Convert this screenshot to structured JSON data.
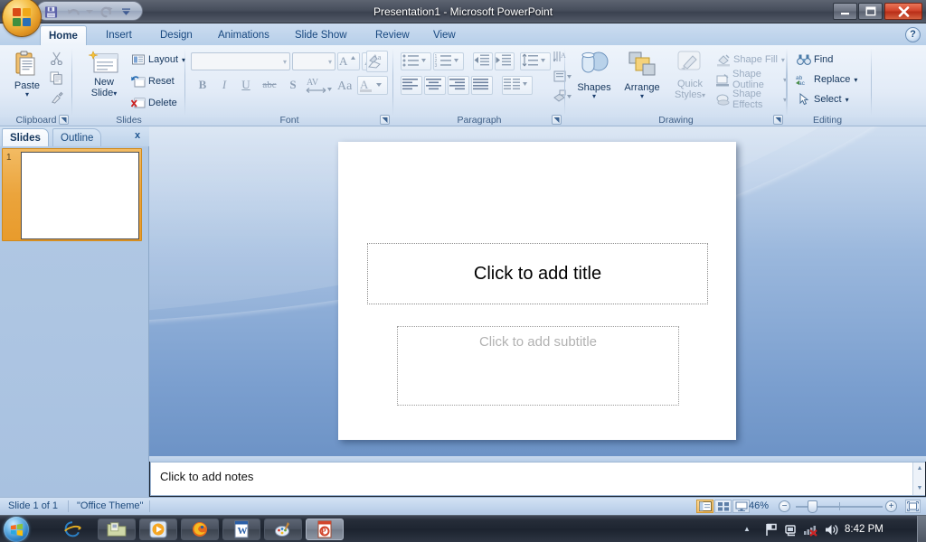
{
  "window": {
    "title": "Presentation1 - Microsoft PowerPoint",
    "minimize_label": "–",
    "maximize_label": "❐",
    "close_label": "✕",
    "help_label": "?"
  },
  "quick_access": {
    "save_icon": "save-icon",
    "undo_icon": "undo-icon",
    "redo_icon": "redo-icon",
    "customize_icon": "chevron-down-icon"
  },
  "office_button": {
    "name": "office-orb"
  },
  "ribbon": {
    "tabs": [
      {
        "label": "Home",
        "active": true
      },
      {
        "label": "Insert",
        "active": false
      },
      {
        "label": "Design",
        "active": false
      },
      {
        "label": "Animations",
        "active": false
      },
      {
        "label": "Slide Show",
        "active": false
      },
      {
        "label": "Review",
        "active": false
      },
      {
        "label": "View",
        "active": false
      }
    ],
    "groups": {
      "clipboard": {
        "label": "Clipboard",
        "paste_label": "Paste",
        "cut_icon": "scissors-icon",
        "copy_icon": "copy-icon",
        "format_painter_icon": "paintbrush-icon",
        "launcher_icon": "dialog-launcher-icon"
      },
      "slides": {
        "label": "Slides",
        "new_slide_label": "New\nSlide",
        "new_slide_line1": "New",
        "new_slide_line2": "Slide",
        "layout_label": "Layout",
        "reset_label": "Reset",
        "delete_label": "Delete"
      },
      "font": {
        "label": "Font",
        "font_name_value": "",
        "font_size_value": "",
        "grow_font_icon": "grow-font-icon",
        "shrink_font_icon": "shrink-font-icon",
        "clear_formatting_icon": "clear-formatting-icon",
        "bold_label": "B",
        "italic_label": "I",
        "underline_label": "U",
        "strikethrough_label": "abc",
        "shadow_label": "S",
        "spacing_label": "AV",
        "change_case_label": "Aa",
        "font_color_label": "A",
        "launcher_icon": "dialog-launcher-icon"
      },
      "paragraph": {
        "label": "Paragraph",
        "bullets_icon": "bullets-icon",
        "numbering_icon": "numbering-icon",
        "decrease_indent_icon": "decrease-indent-icon",
        "increase_indent_icon": "increase-indent-icon",
        "line_spacing_icon": "line-spacing-icon",
        "text_direction_icon": "text-direction-icon",
        "align_text_icon": "align-text-icon",
        "convert_smartart_icon": "smartart-icon",
        "align_left_icon": "align-left-icon",
        "align_center_icon": "align-center-icon",
        "align_right_icon": "align-right-icon",
        "justify_icon": "justify-icon",
        "columns_icon": "columns-icon",
        "launcher_icon": "dialog-launcher-icon"
      },
      "drawing": {
        "label": "Drawing",
        "shapes_label": "Shapes",
        "arrange_label": "Arrange",
        "quick_styles_line1": "Quick",
        "quick_styles_line2": "Styles",
        "shape_fill_label": "Shape Fill",
        "shape_outline_label": "Shape Outline",
        "shape_effects_label": "Shape Effects",
        "launcher_icon": "dialog-launcher-icon"
      },
      "editing": {
        "label": "Editing",
        "find_label": "Find",
        "replace_label": "Replace",
        "select_label": "Select",
        "find_icon": "binoculars-icon",
        "replace_icon": "replace-icon",
        "select_icon": "cursor-arrow-icon"
      }
    }
  },
  "left_panel": {
    "tabs": [
      {
        "label": "Slides",
        "active": true
      },
      {
        "label": "Outline",
        "active": false
      }
    ],
    "close_label": "x",
    "thumbnails": [
      {
        "number": "1",
        "selected": true
      }
    ]
  },
  "slide": {
    "title_placeholder": "Click to add title",
    "subtitle_placeholder": "Click to add subtitle"
  },
  "notes": {
    "placeholder": "Click to add notes"
  },
  "status_bar": {
    "slide_counter": "Slide 1 of 1",
    "theme_name": "\"Office Theme\"",
    "zoom_percent": "46%",
    "zoom_out_label": "−",
    "zoom_in_label": "+",
    "views": [
      {
        "name": "normal-view",
        "active": true
      },
      {
        "name": "slide-sorter-view",
        "active": false
      },
      {
        "name": "slide-show-view",
        "active": false
      }
    ],
    "fit_icon": "fit-to-window-icon"
  },
  "taskbar": {
    "start_label": "start-orb",
    "items": [
      {
        "name": "internet-explorer-icon",
        "active": false
      },
      {
        "name": "windows-explorer-icon",
        "active": false
      },
      {
        "name": "media-player-icon",
        "active": false
      },
      {
        "name": "firefox-icon",
        "active": false
      },
      {
        "name": "word-icon",
        "active": false
      },
      {
        "name": "paint-icon",
        "active": false
      },
      {
        "name": "powerpoint-icon",
        "active": true
      }
    ],
    "tray": {
      "show_hidden_label": "▲",
      "flag_icon": "action-center-flag-icon",
      "network_icon": "network-disconnected-icon",
      "volume_icon": "volume-icon",
      "clock": "8:42 PM"
    }
  },
  "colors": {
    "accent_orange": "#eba43c",
    "ribbon_blue": "#c6d7ec",
    "title_gray": "#474e5c",
    "close_red": "#d2452c"
  }
}
